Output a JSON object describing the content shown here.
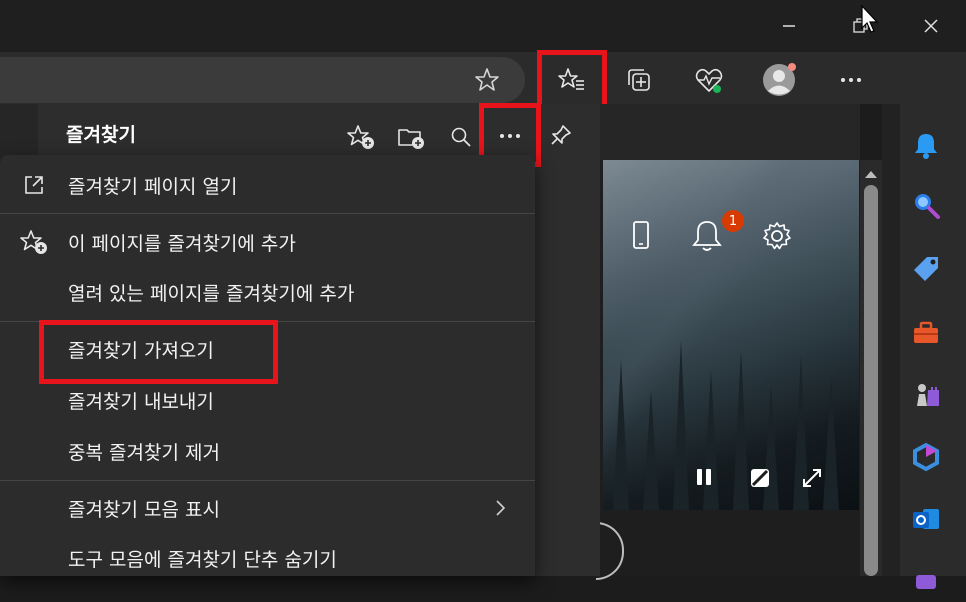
{
  "favorites_pane": {
    "title": "즐겨찾기"
  },
  "menu": {
    "items": [
      {
        "label": "즐겨찾기 페이지 열기",
        "icon": "open-external-icon"
      },
      {
        "label": "이 페이지를 즐겨찾기에 추가",
        "icon": "star-add-icon"
      },
      {
        "label": "열려 있는 페이지를 즐겨찾기에 추가",
        "icon": ""
      },
      {
        "label": "즐겨찾기 가져오기",
        "icon": ""
      },
      {
        "label": "즐겨찾기 내보내기",
        "icon": ""
      },
      {
        "label": "중복 즐겨찾기 제거",
        "icon": ""
      },
      {
        "label": "즐겨찾기 모음 표시",
        "icon": "chevron-right-icon"
      },
      {
        "label": "도구 모음에 즐겨찾기 단추 숨기기",
        "icon": ""
      }
    ]
  },
  "notifications": {
    "badge_count": "1"
  },
  "colors": {
    "highlight": "#e8141b",
    "badge": "#d83b01",
    "accent_blue": "#1e90ff"
  }
}
